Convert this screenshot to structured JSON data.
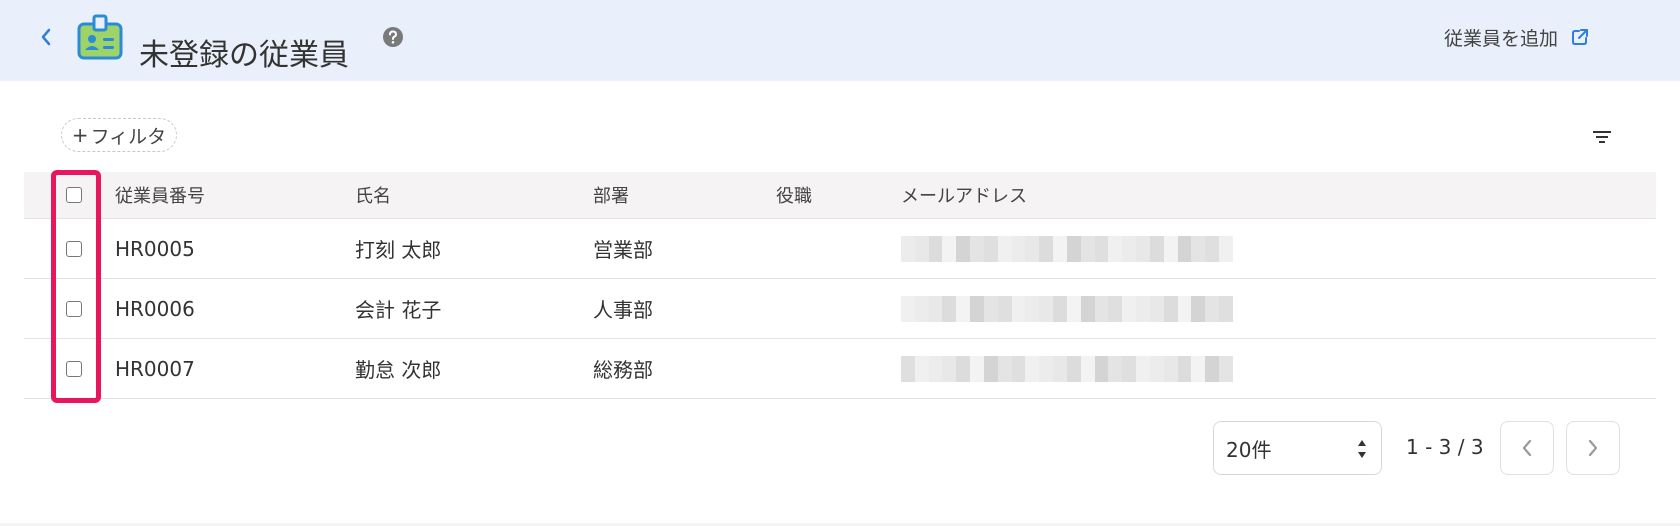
{
  "header": {
    "title": "未登録の従業員",
    "add_link_label": "従業員を追加"
  },
  "toolbar": {
    "filter_label": "フィルタ",
    "filter_plus": "+"
  },
  "table": {
    "columns": [
      "従業員番号",
      "氏名",
      "部署",
      "役職",
      "メールアドレス"
    ],
    "rows": [
      {
        "id": "HR0005",
        "name": "打刻 太郎",
        "dept": "営業部",
        "role": "",
        "email": ""
      },
      {
        "id": "HR0006",
        "name": "会計 花子",
        "dept": "人事部",
        "role": "",
        "email": ""
      },
      {
        "id": "HR0007",
        "name": "勤怠 次郎",
        "dept": "総務部",
        "role": "",
        "email": ""
      }
    ]
  },
  "pagination": {
    "per_page": "20件",
    "range": "1 - 3 / 3"
  },
  "icons": {
    "back": "chevron-left-icon",
    "badge": "employee-badge-icon",
    "help": "help-circle-icon",
    "external": "external-link-icon",
    "filter_list": "filter-list-icon"
  },
  "colors": {
    "accent": "#2f7fd8",
    "header_bg": "#e9f0fb",
    "highlight": "#e8175d",
    "badge_fill": "#9ed36a",
    "badge_stroke": "#2a8bd6"
  }
}
